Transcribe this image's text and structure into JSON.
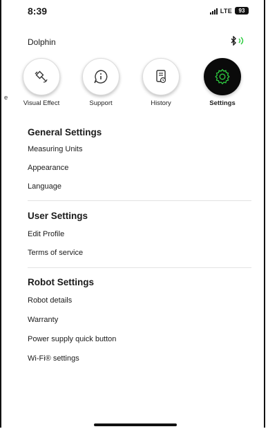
{
  "status_bar": {
    "time": "8:39",
    "network": "LTE",
    "battery": "93"
  },
  "header": {
    "title": "Dolphin"
  },
  "tabs": [
    {
      "label": "Visual Effect",
      "icon": "satellite-icon"
    },
    {
      "label": "Support",
      "icon": "info-bubble-icon"
    },
    {
      "label": "History",
      "icon": "history-clipboard-icon"
    },
    {
      "label": "Settings",
      "icon": "gear-icon",
      "active": true
    }
  ],
  "partial_tab_label": "e",
  "general_settings": {
    "heading": "General Settings",
    "items": [
      "Measuring Units",
      "Appearance",
      "Language"
    ]
  },
  "user_settings": {
    "heading": "User Settings",
    "items": [
      "Edit Profile",
      "Terms of service"
    ]
  },
  "robot_settings": {
    "heading": "Robot Settings",
    "items": [
      "Robot details",
      "Warranty",
      "Power supply quick button",
      "Wi-Fi® settings"
    ]
  },
  "colors": {
    "active_tab_bg": "#0a0a0a",
    "active_icon": "#2ecc40",
    "bluetooth_waves": "#2ecc40"
  }
}
